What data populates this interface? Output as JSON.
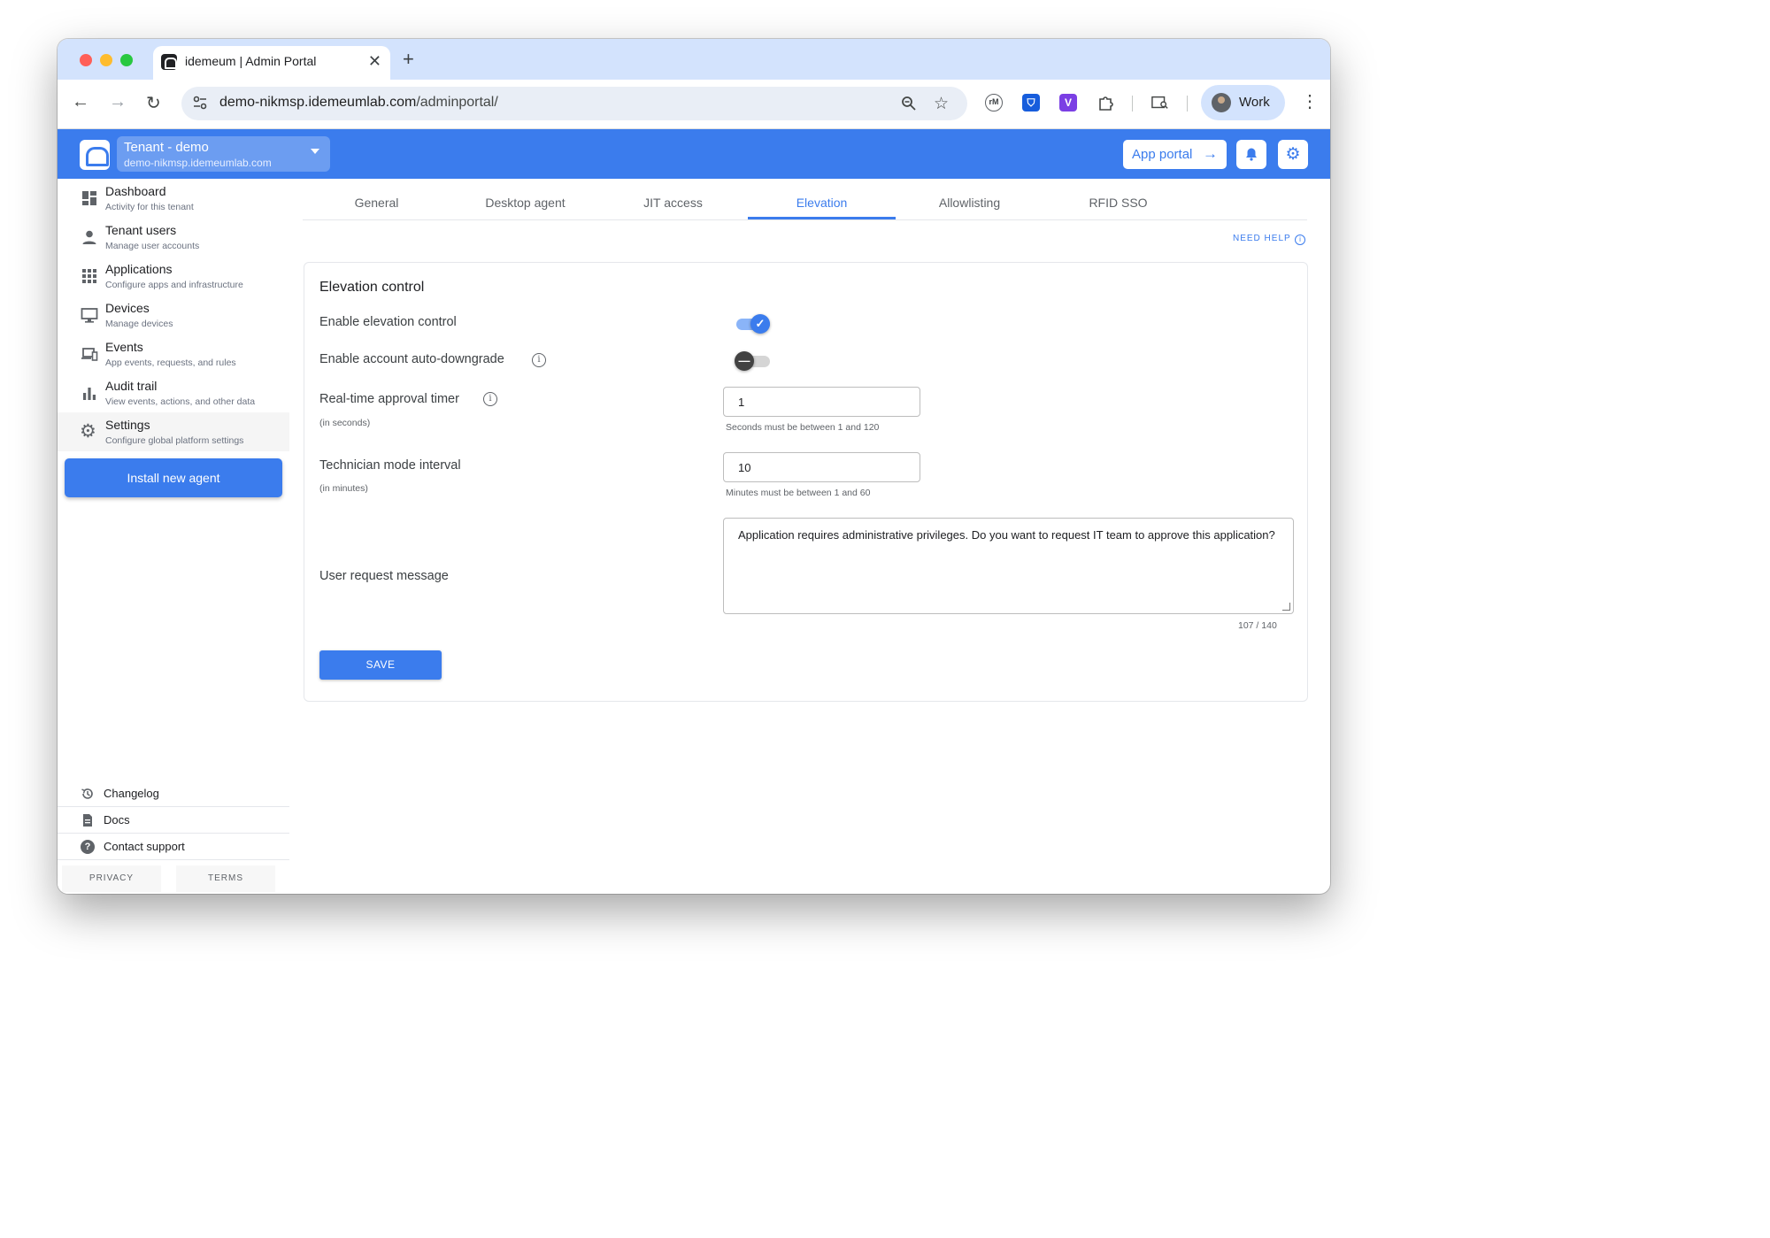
{
  "browser": {
    "tab_title": "idemeum | Admin Portal",
    "tab_close": "✕",
    "new_tab": "+",
    "url_host": "demo-nikmsp.idemeumlab.com",
    "url_path": "/adminportal/",
    "profile_label": "Work",
    "extensions": [
      "rM",
      "bitwarden",
      "V",
      "puzzle"
    ]
  },
  "header": {
    "tenant_name": "Tenant - demo",
    "tenant_host": "demo-nikmsp.idemeumlab.com",
    "app_portal_label": "App portal",
    "accent": "#3b7ced"
  },
  "sidebar": {
    "items": [
      {
        "title": "Dashboard",
        "subtitle": "Activity for this tenant",
        "icon": "dashboard-icon"
      },
      {
        "title": "Tenant users",
        "subtitle": "Manage user accounts",
        "icon": "person-icon"
      },
      {
        "title": "Applications",
        "subtitle": "Configure apps and infrastructure",
        "icon": "apps-grid-icon"
      },
      {
        "title": "Devices",
        "subtitle": "Manage devices",
        "icon": "monitor-icon"
      },
      {
        "title": "Events",
        "subtitle": "App events, requests, and rules",
        "icon": "devices-icon"
      },
      {
        "title": "Audit trail",
        "subtitle": "View events, actions, and other data",
        "icon": "bar-chart-icon"
      },
      {
        "title": "Settings",
        "subtitle": "Configure global platform settings",
        "icon": "gear-icon"
      }
    ],
    "install_button": "Install new agent",
    "footer": [
      {
        "label": "Changelog",
        "icon": "history-icon"
      },
      {
        "label": "Docs",
        "icon": "document-icon"
      },
      {
        "label": "Contact support",
        "icon": "help-icon"
      }
    ],
    "privacy": "PRIVACY",
    "terms": "TERMS"
  },
  "main": {
    "tabs": [
      "General",
      "Desktop agent",
      "JIT access",
      "Elevation",
      "Allowlisting",
      "RFID SSO"
    ],
    "active_tab": "Elevation",
    "need_help": "NEED HELP",
    "card_title": "Elevation control",
    "enable_elevation_label": "Enable elevation control",
    "enable_elevation_value": true,
    "auto_downgrade_label": "Enable account auto-downgrade",
    "auto_downgrade_value": false,
    "approval_timer_label": "Real-time approval timer",
    "approval_timer_hint": "(in seconds)",
    "approval_timer_value": "1",
    "approval_timer_help": "Seconds must be between 1 and 120",
    "technician_label": "Technician mode interval",
    "technician_hint": "(in minutes)",
    "technician_value": "10",
    "technician_help": "Minutes must be between 1 and 60",
    "message_label": "User request message",
    "message_value": "Application requires administrative privileges. Do you want to request IT team to approve this application?",
    "message_counter": "107 / 140",
    "save_label": "SAVE"
  }
}
